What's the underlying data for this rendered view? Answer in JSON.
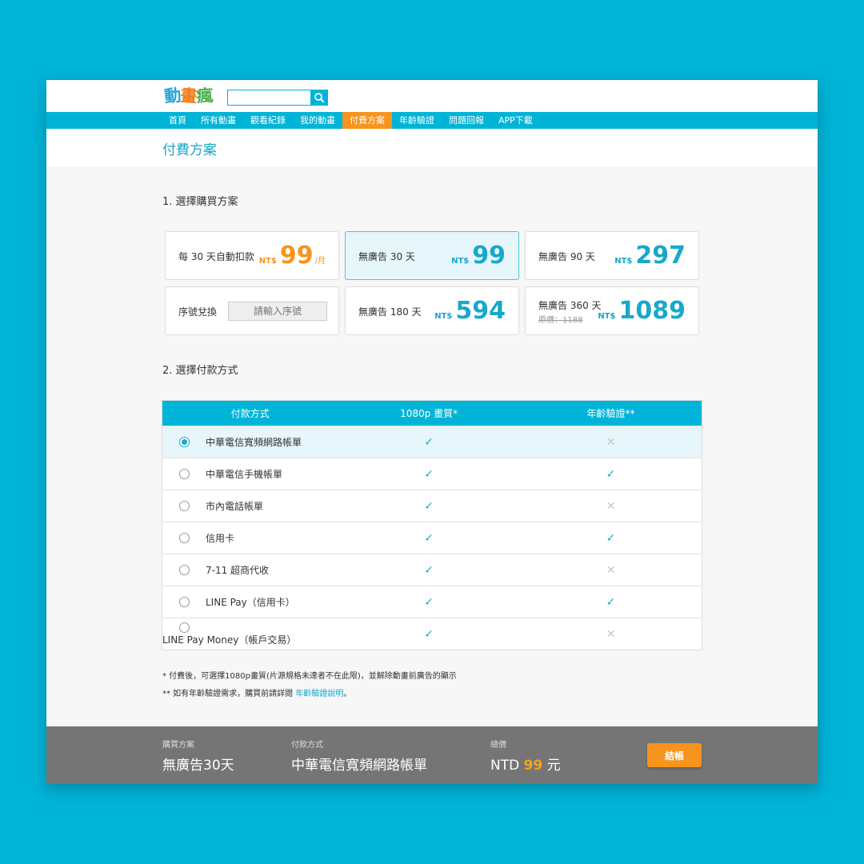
{
  "header": {
    "logo_chars": [
      "動",
      "畫",
      "瘋"
    ],
    "logo_colors": [
      "#2aa4d8",
      "#f07c1e",
      "#4cae4c"
    ],
    "search_placeholder": "",
    "search_icon": "search-icon"
  },
  "nav": {
    "items": [
      {
        "label": "首頁",
        "active": false
      },
      {
        "label": "所有動畫",
        "active": false
      },
      {
        "label": "觀看紀錄",
        "active": false
      },
      {
        "label": "我的動畫",
        "active": false
      },
      {
        "label": "付費方案",
        "active": true
      },
      {
        "label": "年齡驗證",
        "active": false
      },
      {
        "label": "問題回報",
        "active": false
      },
      {
        "label": "APP下載",
        "active": false
      }
    ]
  },
  "page": {
    "title": "付費方案",
    "section1": "1. 選擇購買方案",
    "section2": "2. 選擇付款方式"
  },
  "plans": {
    "monthly": {
      "name": "每 30 天自動扣款",
      "currency": "NT$",
      "amount": "99",
      "unit": "/月"
    },
    "p30": {
      "name": "無廣告 30 天",
      "currency": "NT$",
      "amount": "99",
      "selected": true
    },
    "p90": {
      "name": "無廣告 90 天",
      "currency": "NT$",
      "amount": "297"
    },
    "serial": {
      "name": "序號兌換",
      "placeholder": "請輸入序號"
    },
    "p180": {
      "name": "無廣告 180 天",
      "currency": "NT$",
      "amount": "594"
    },
    "p360": {
      "name": "無廣告 360 天",
      "original": "原價：1188",
      "currency": "NT$",
      "amount": "1089"
    }
  },
  "payment_table": {
    "headers": [
      "付款方式",
      "1080p 畫質*",
      "年齡驗證**"
    ],
    "rows": [
      {
        "name": "中華電信寬頻網路帳單",
        "hd": true,
        "age": false,
        "selected": true
      },
      {
        "name": "中華電信手機帳單",
        "hd": true,
        "age": true,
        "selected": false
      },
      {
        "name": "市內電話帳單",
        "hd": true,
        "age": false,
        "selected": false
      },
      {
        "name": "信用卡",
        "hd": true,
        "age": true,
        "selected": false
      },
      {
        "name": "7-11 超商代收",
        "hd": true,
        "age": false,
        "selected": false
      },
      {
        "name": "LINE Pay（信用卡）",
        "hd": true,
        "age": true,
        "selected": false
      },
      {
        "name": "LINE Pay Money（帳戶交易）",
        "hd": true,
        "age": false,
        "selected": false
      }
    ],
    "check_glyph": "✓",
    "cross_glyph": "✕"
  },
  "notes": {
    "note1": "* 付費後，可選擇1080p畫質(片源規格未達者不在此限)，並解除動畫前廣告的顯示",
    "note2_prefix": "** 如有年齡驗證需求，購買前請詳閱 ",
    "note2_link": "年齡驗證說明",
    "note2_suffix": "。"
  },
  "footer": {
    "plan_label": "購買方案",
    "plan_value": "無廣告30天",
    "method_label": "付款方式",
    "method_value": "中華電信寬頻網路帳單",
    "total_label": "總價",
    "total_prefix": "NTD",
    "total_amount": "99",
    "total_suffix": "元",
    "checkout_label": "結帳"
  },
  "colors": {
    "background": "#00b4d8",
    "accent": "#18a8cc",
    "active_nav": "#f7941d",
    "footer": "#757575"
  }
}
